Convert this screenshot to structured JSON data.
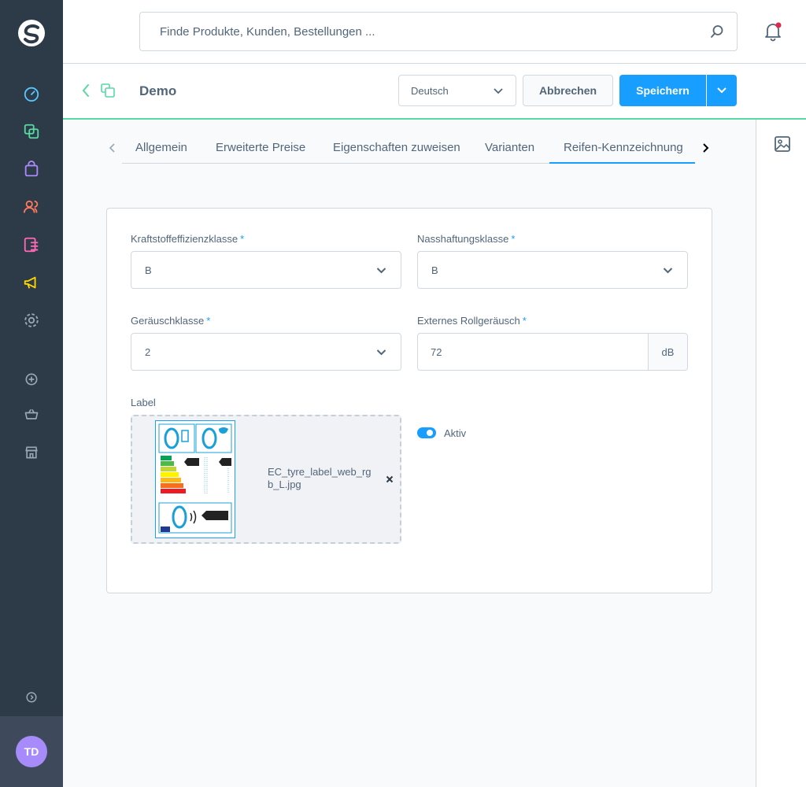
{
  "search": {
    "placeholder": "Finde Produkte, Kunden, Bestellungen ..."
  },
  "smartbar": {
    "title": "Demo",
    "language": "Deutsch",
    "cancel_label": "Abbrechen",
    "save_label": "Speichern"
  },
  "tabs": [
    {
      "label": "Allgemein"
    },
    {
      "label": "Erweiterte Preise"
    },
    {
      "label": "Eigenschaften zuweisen"
    },
    {
      "label": "Varianten"
    },
    {
      "label": "Reifen-Kennzeichnung",
      "active": true
    }
  ],
  "form": {
    "fuel_efficiency": {
      "label": "Kraftstoffeffizienzklasse",
      "required": "*",
      "value": "B"
    },
    "wet_grip": {
      "label": "Nasshaftungsklasse",
      "required": "*",
      "value": "B"
    },
    "noise_class": {
      "label": "Geräuschklasse",
      "required": "*",
      "value": "2"
    },
    "rolling_noise": {
      "label": "Externes Rollgeräusch",
      "required": "*",
      "value": "72",
      "unit": "dB"
    },
    "label_field": {
      "label": "Label",
      "file_name": "EC_tyre_label_web_rgb_L.jpg"
    },
    "active": {
      "label": "Aktiv",
      "on": true
    }
  },
  "user": {
    "initials": "TD"
  },
  "colors": {
    "sidebar": "#2d3a48",
    "accent": "#189eff",
    "brand_green": "#57d9a3",
    "avatar": "#a78bfa"
  },
  "icons": [
    "dashboard-icon",
    "catalog-icon",
    "orders-icon",
    "customers-icon",
    "content-icon",
    "marketing-icon",
    "settings-icon",
    "add-icon",
    "sales-channel-basket-icon",
    "storefront-icon",
    "expand-icon"
  ]
}
